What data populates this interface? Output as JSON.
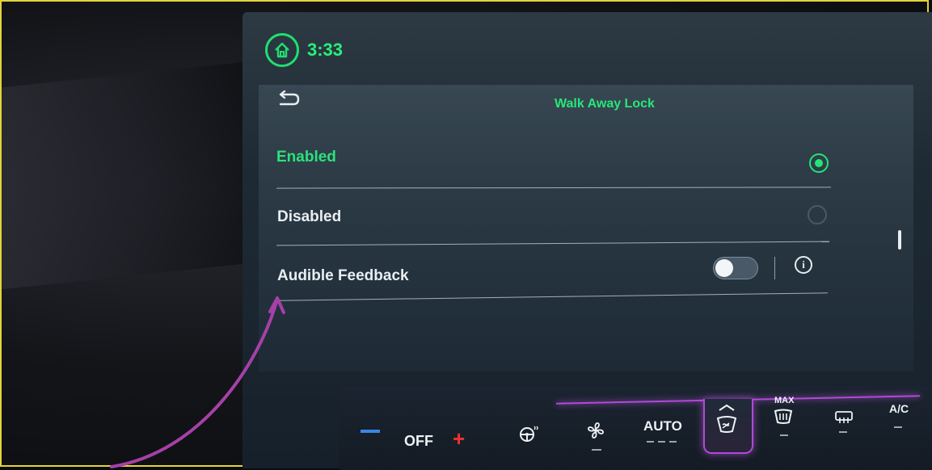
{
  "status": {
    "time": "3:33"
  },
  "page": {
    "title": "Walk Away Lock"
  },
  "options": {
    "enabled": {
      "label": "Enabled",
      "selected": true
    },
    "disabled": {
      "label": "Disabled",
      "selected": false
    },
    "audible_feedback": {
      "label": "Audible Feedback",
      "on": false
    }
  },
  "climate": {
    "off_label": "OFF",
    "plus_label": "+",
    "auto_label": "AUTO",
    "max_label": "MAX",
    "ac_label": "A/C"
  },
  "colors": {
    "accent_green": "#27e67a",
    "climate_highlight": "#b04ad8",
    "annotation_arrow": "#a640a8",
    "frame_border": "#e3d43a"
  },
  "icons": [
    "home-icon",
    "back-arrow-icon",
    "radio-selected-icon",
    "radio-unselected-icon",
    "info-icon",
    "heated-steering-wheel-icon",
    "fan-icon",
    "windshield-defrost-icon",
    "max-defrost-icon",
    "rear-defrost-icon"
  ]
}
